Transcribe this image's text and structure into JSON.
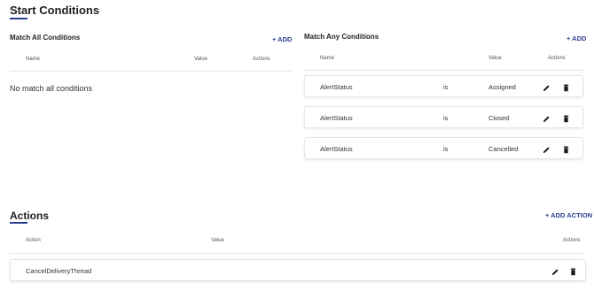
{
  "start_conditions": {
    "title": "Start Conditions",
    "match_all": {
      "title": "Match All Conditions",
      "add_label": "+ ADD",
      "columns": [
        "Name",
        "Value",
        "Actions"
      ],
      "empty_message": "No match all conditions"
    },
    "match_any": {
      "title": "Match Any Conditions",
      "add_label": "+ ADD",
      "columns": [
        "Name",
        "Value",
        "Actions"
      ],
      "rows": [
        {
          "name": "AlertStatus",
          "operator": "is",
          "value": "Assigned"
        },
        {
          "name": "AlertStatus",
          "operator": "is",
          "value": "Closed"
        },
        {
          "name": "AlertStatus",
          "operator": "is",
          "value": "Cancelled"
        }
      ]
    }
  },
  "actions": {
    "title": "Actions",
    "add_label": "+ ADD ACTION",
    "columns": [
      "Action",
      "Value",
      "Actions"
    ],
    "rows": [
      {
        "action": "CancelDeliveryThread",
        "value": ""
      }
    ]
  },
  "icons": {
    "edit": "pencil-icon",
    "delete": "trash-icon"
  },
  "colors": {
    "accent": "#2a3e8f"
  }
}
